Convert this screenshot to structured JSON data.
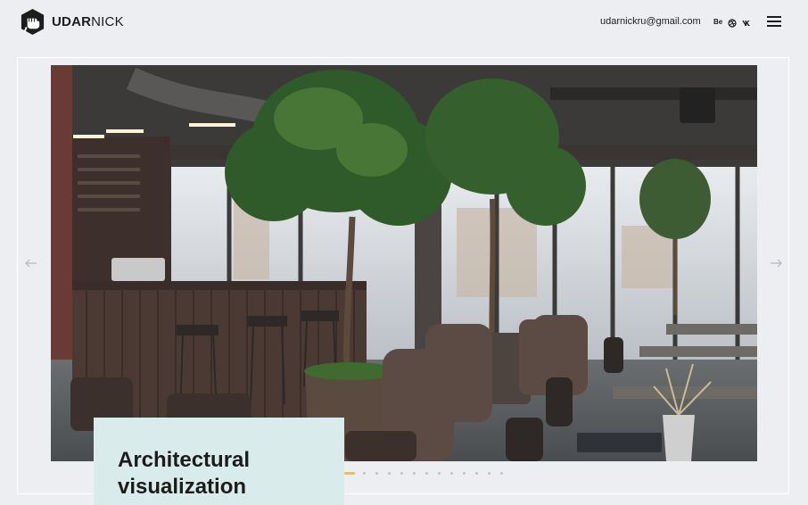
{
  "header": {
    "logo_bold": "UDAR",
    "logo_light": "NICK",
    "email": "udarnickru@gmail.com",
    "socials": [
      {
        "label": "Be",
        "icon": "behance-icon"
      },
      {
        "label": "",
        "icon": "dribbble-icon"
      },
      {
        "label": "",
        "icon": "vk-icon"
      }
    ],
    "menu_icon": "hamburger-menu-icon"
  },
  "slider": {
    "caption_title": "Architectural visualization",
    "slide_count": 13,
    "active_index": 0,
    "image_description_icon": "cafe-interior-render"
  },
  "colors": {
    "background": "#eceef2",
    "caption_bg": "#d9ebea",
    "accent_dot": "#f2c230",
    "dot": "#bfc3c8"
  }
}
